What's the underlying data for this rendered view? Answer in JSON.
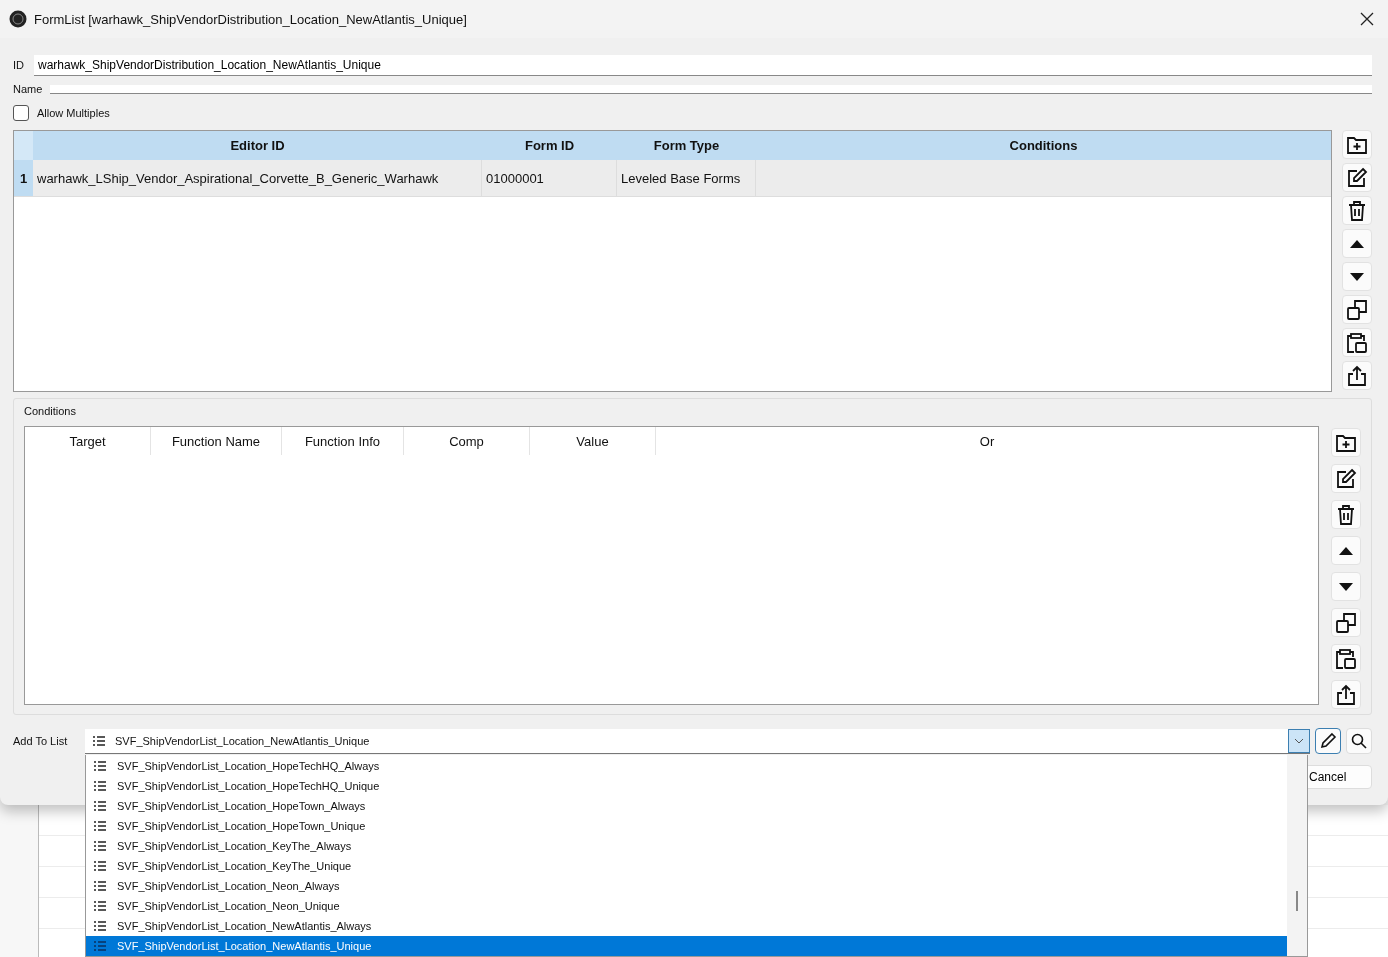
{
  "window": {
    "title": "FormList [warhawk_ShipVendorDistribution_Location_NewAtlantis_Unique]"
  },
  "id_field": {
    "label": "ID",
    "value": "warhawk_ShipVendorDistribution_Location_NewAtlantis_Unique"
  },
  "name_field": {
    "label": "Name"
  },
  "allow_multiples": {
    "label": "Allow Multiples",
    "checked": false
  },
  "form_table": {
    "columns": [
      "Editor ID",
      "Form ID",
      "Form Type",
      "Conditions"
    ],
    "rows": [
      {
        "index": "1",
        "editor_id": "warhawk_LShip_Vendor_Aspirational_Corvette_B_Generic_Warhawk",
        "form_id": "01000001",
        "form_type": "Leveled Base Forms",
        "selected": true
      }
    ]
  },
  "conditions": {
    "title": "Conditions",
    "columns": [
      "Target",
      "Function Name",
      "Function Info",
      "Comp",
      "Value",
      "Or"
    ]
  },
  "add_to_list": {
    "label": "Add To List",
    "value": "SVF_ShipVendorList_Location_NewAtlantis_Unique",
    "expanded": true,
    "options": [
      {
        "label": "SVF_ShipVendorList_Location_HopeTechHQ_Always",
        "selected": false
      },
      {
        "label": "SVF_ShipVendorList_Location_HopeTechHQ_Unique",
        "selected": false
      },
      {
        "label": "SVF_ShipVendorList_Location_HopeTown_Always",
        "selected": false
      },
      {
        "label": "SVF_ShipVendorList_Location_HopeTown_Unique",
        "selected": false
      },
      {
        "label": "SVF_ShipVendorList_Location_KeyThe_Always",
        "selected": false
      },
      {
        "label": "SVF_ShipVendorList_Location_KeyThe_Unique",
        "selected": false
      },
      {
        "label": "SVF_ShipVendorList_Location_Neon_Always",
        "selected": false
      },
      {
        "label": "SVF_ShipVendorList_Location_Neon_Unique",
        "selected": false
      },
      {
        "label": "SVF_ShipVendorList_Location_NewAtlantis_Always",
        "selected": false
      },
      {
        "label": "SVF_ShipVendorList_Location_NewAtlantis_Unique",
        "selected": true
      }
    ]
  },
  "buttons": [
    {
      "label": "Cancel"
    }
  ]
}
